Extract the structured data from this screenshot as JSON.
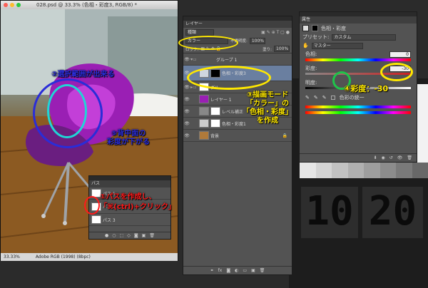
{
  "document": {
    "title": "028.psd @ 33.3% (色相・彩度3, RGB/8) *",
    "zoom": "33.33%",
    "profile": "Adobe RGB (1998) (8bpc)"
  },
  "layers_panel": {
    "tab": "レイヤー",
    "filter": "種類",
    "blend_mode": "カラー",
    "opacity_label": "不透明度:",
    "opacity": "100%",
    "lock_label": "ロック:",
    "fill_label": "塗り:",
    "fill": "100%",
    "layers": [
      {
        "name": "グループ 1"
      },
      {
        "name": "色相・彩度3"
      },
      {
        "name": "グル"
      },
      {
        "name": "レイヤー 1"
      },
      {
        "name": "レベル補正"
      },
      {
        "name": "色相・彩度1"
      },
      {
        "name": "背景"
      }
    ]
  },
  "properties_panel": {
    "tab": "属性",
    "header": "色相・彩度",
    "preset_label": "プリセット:",
    "preset_value": "カスタム",
    "range_value": "マスター",
    "hue_label": "色相:",
    "hue_value": "0",
    "saturation_label": "彩度:",
    "saturation_value": "-30",
    "lightness_label": "明度:",
    "lightness_value": "0",
    "colorize_label": "色彩の統一"
  },
  "paths_panel": {
    "tab": "パス",
    "paths": [
      "パス 1",
      "パス 2",
      "パス 3"
    ]
  },
  "background_numbers": [
    "10",
    "20"
  ],
  "annotations": {
    "a2": "②選択範囲が出来る",
    "a3": [
      "③描画モード",
      "「カラー」の",
      "「色相・彩度」",
      "を作成"
    ],
    "a4": "④彩度：-30",
    "a5": [
      "⑤背中面の",
      "彩度が下がる"
    ],
    "a1": [
      "①パスを作成し、",
      "「⌘(ctrl)+クリック」"
    ]
  },
  "colors": {
    "yellow": "#ffe800",
    "blue": "#2a2dd8",
    "cyan": "#1fd6d6",
    "red": "#ff1a1a",
    "purple": "#8a2aa8"
  }
}
